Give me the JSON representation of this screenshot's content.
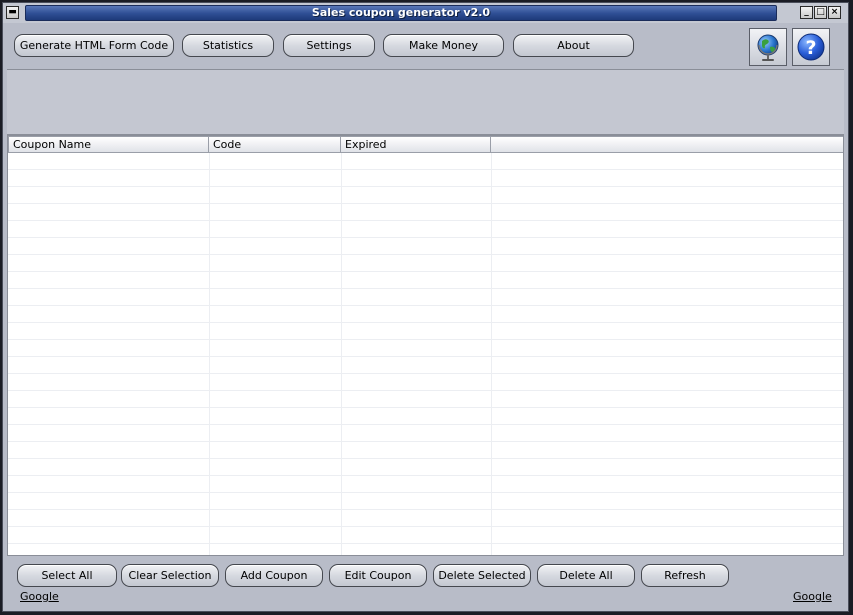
{
  "window": {
    "title": "Sales coupon generator v2.0",
    "controls": {
      "minimize": "_",
      "maximize": "□",
      "close": "×",
      "menu": "▬"
    }
  },
  "toolbar": {
    "buttons": [
      {
        "label": "Generate HTML Form Code"
      },
      {
        "label": "Statistics"
      },
      {
        "label": "Settings"
      },
      {
        "label": "Make Money"
      },
      {
        "label": "About"
      }
    ],
    "icons": [
      "globe-icon",
      "help-icon"
    ]
  },
  "table": {
    "columns": [
      "Coupon Name",
      "Code",
      "Expired",
      ""
    ],
    "rows": []
  },
  "actions": {
    "buttons": [
      {
        "label": "Select All"
      },
      {
        "label": "Clear Selection"
      },
      {
        "label": "Add Coupon"
      },
      {
        "label": "Edit Coupon"
      },
      {
        "label": "Delete Selected"
      },
      {
        "label": "Delete All"
      },
      {
        "label": "Refresh"
      }
    ]
  },
  "links": {
    "left": "Google",
    "right": "Google"
  }
}
